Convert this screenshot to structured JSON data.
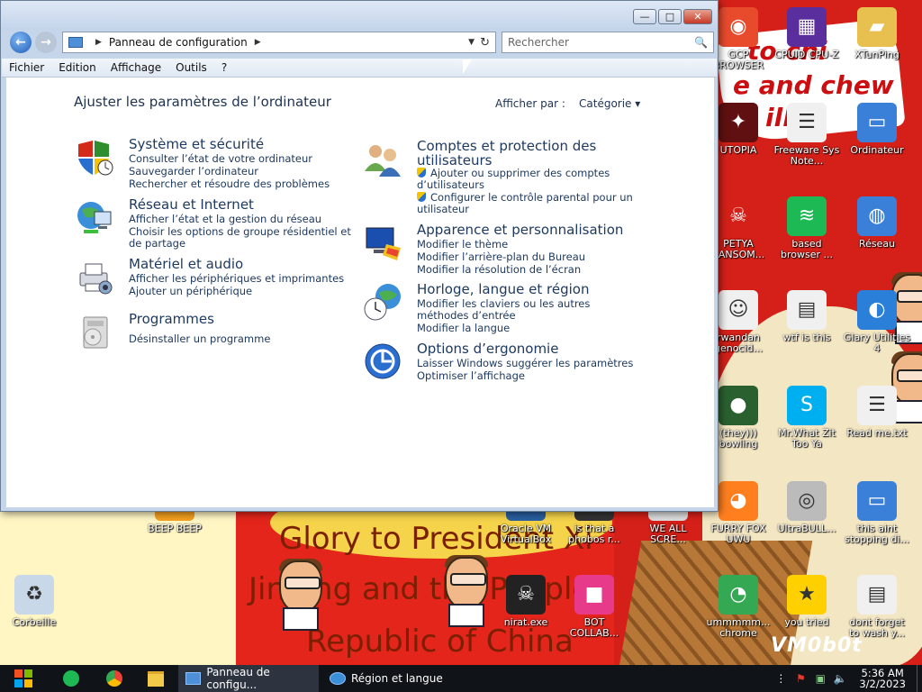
{
  "window": {
    "title": "Panneau de configuration",
    "controls": {
      "minimize": "—",
      "maximize": "□",
      "close": "✕"
    },
    "address": {
      "crumb": "Panneau de configuration",
      "separator": "▶",
      "dropdown": "▼",
      "refresh": "↻"
    },
    "search": {
      "placeholder": "Rechercher",
      "icon": "🔍"
    },
    "nav": {
      "back": "←",
      "forward": "→"
    },
    "menu": [
      "Fichier",
      "Edition",
      "Affichage",
      "Outils",
      "?"
    ]
  },
  "panel": {
    "title": "Ajuster les paramètres de l’ordinateur",
    "view_by_label": "Afficher par :",
    "view_by_value": "Catégorie ▾",
    "categories": [
      {
        "title": "Système et sécurité",
        "links": [
          "Consulter l’état de votre ordinateur",
          "Sauvegarder l’ordinateur",
          "Rechercher et résoudre des problèmes"
        ]
      },
      {
        "title": "Réseau et Internet",
        "links": [
          "Afficher l’état et la gestion du réseau",
          "Choisir les options de groupe résidentiel et de partage"
        ]
      },
      {
        "title": "Matériel et audio",
        "links": [
          "Afficher les périphériques et imprimantes",
          "Ajouter un périphérique"
        ]
      },
      {
        "title": "Programmes",
        "links": [
          "Désinstaller un programme"
        ]
      },
      {
        "title": "Comptes et protection des utilisateurs",
        "links": [
          "Ajouter ou supprimer des comptes d’utilisateurs",
          "Configurer le contrôle parental pour un utilisateur"
        ]
      },
      {
        "title": "Apparence et personnalisation",
        "links": [
          "Modifier le thème",
          "Modifier l’arrière-plan du Bureau",
          "Modifier la résolution de l’écran"
        ]
      },
      {
        "title": "Horloge, langue et région",
        "links": [
          "Modifier les claviers ou les autres méthodes d’entrée",
          "Modifier la langue"
        ]
      },
      {
        "title": "Options d’ergonomie",
        "links": [
          "Laisser Windows suggérer les paramètres",
          "Optimiser l’affichage"
        ]
      }
    ]
  },
  "desktop": {
    "wallpaper_text": [
      "to chi",
      "e and chew",
      "illi",
      "Glory to President Xi",
      "Jinping and the People's",
      "Republic of China"
    ],
    "watermark": "VM0b0t",
    "icons": [
      {
        "label": "GCP BROWSER",
        "icon": "gcp-browser-icon",
        "color": "#e84a2c"
      },
      {
        "label": "CPUID CPU-Z",
        "icon": "cpuz-icon",
        "color": "#5a2e9c"
      },
      {
        "label": "XTunPing",
        "icon": "folder-person-icon",
        "color": "#e8c050"
      },
      {
        "label": "UTOPIA",
        "icon": "utopia-icon",
        "color": "#601010"
      },
      {
        "label": "Freeware Sys Note...",
        "icon": "text-file-icon",
        "color": "#f0f0f0"
      },
      {
        "label": "Ordinateur",
        "icon": "computer-icon",
        "color": "#3a7fd8"
      },
      {
        "label": "PETYA RANSOM...",
        "icon": "skull-icon",
        "color": "#d42018"
      },
      {
        "label": "based browser ...",
        "icon": "spotify-icon",
        "color": "#1db954"
      },
      {
        "label": "Réseau",
        "icon": "network-icon",
        "color": "#3a7fd8"
      },
      {
        "label": "rwandan genocid...",
        "icon": "meme-face-icon",
        "color": "#f0f0f0"
      },
      {
        "label": "wtf is this",
        "icon": "document-icon",
        "color": "#f0f0f0"
      },
      {
        "label": "Glary Utilities 4",
        "icon": "glary-icon",
        "color": "#2a7fd8"
      },
      {
        "label": "(they))) bowling",
        "icon": "bowling-icon",
        "color": "#2a6030"
      },
      {
        "label": "Mr.What Zit Too Ya",
        "icon": "skype-icon",
        "color": "#00aff0"
      },
      {
        "label": "Read me.txt",
        "icon": "text-file-icon",
        "color": "#f0f0f0"
      },
      {
        "label": "BEEP BEEP",
        "icon": "app-icon",
        "color": "#f5a020"
      },
      {
        "label": "Oracle VM VirtualBox",
        "icon": "virtualbox-icon",
        "color": "#2a5fa0"
      },
      {
        "label": "is that a phobos r...",
        "icon": "app-icon",
        "color": "#333"
      },
      {
        "label": "WE ALL SCRE...",
        "icon": "app-icon",
        "color": "#ddd"
      },
      {
        "label": "FURRY FOX UWU",
        "icon": "firefox-icon",
        "color": "#ff7f1f"
      },
      {
        "label": "UltraBULL...",
        "icon": "disc-icon",
        "color": "#bbb"
      },
      {
        "label": "this aint stopping di...",
        "icon": "computer-icon",
        "color": "#3a7fd8"
      },
      {
        "label": "Corbeille",
        "icon": "recycle-bin-icon",
        "color": "#c8d8e8"
      },
      {
        "label": "nirat.exe",
        "icon": "skull-icon",
        "color": "#222"
      },
      {
        "label": "BOT COLLAB...",
        "icon": "app-icon",
        "color": "#e83a8a"
      },
      {
        "label": "ummmmm... chrome",
        "icon": "chrome-icon",
        "color": "#34a853"
      },
      {
        "label": "you tried",
        "icon": "star-icon",
        "color": "#ffd000"
      },
      {
        "label": "dont forget to wash y...",
        "icon": "document-icon",
        "color": "#f0f0f0"
      }
    ]
  },
  "taskbar": {
    "tasks": [
      {
        "label": "Panneau de configu...",
        "active": true
      },
      {
        "label": "Région et langue",
        "active": false
      }
    ],
    "clock_time": "5:36 AM",
    "clock_date": "3/2/2023"
  }
}
